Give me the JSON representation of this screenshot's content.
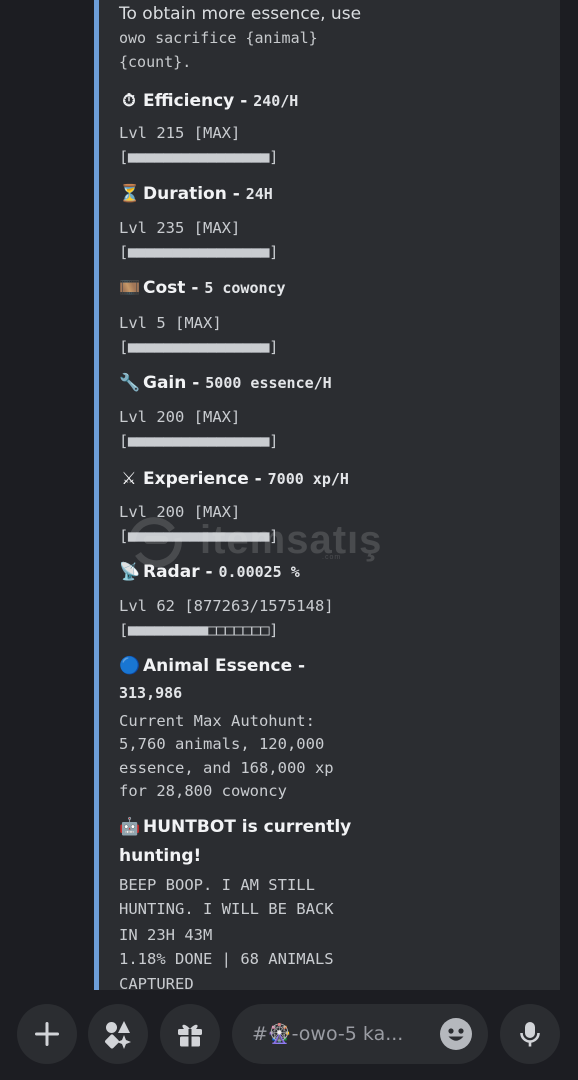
{
  "intro": {
    "line1": "To obtain more essence, use",
    "line2": "owo sacrifice {animal}",
    "line3": "{count}."
  },
  "stats": {
    "efficiency": {
      "emoji": "⏱",
      "name": "Efficiency",
      "value": "240/H",
      "level": "Lvl 215 [MAX]",
      "bar": "[■■■■■■■■■■■■■■■■]"
    },
    "duration": {
      "emoji": "⏳",
      "name": "Duration",
      "value": "24H",
      "level": "Lvl 235 [MAX]",
      "bar": "[■■■■■■■■■■■■■■■■]"
    },
    "cost": {
      "emoji": "🎞️",
      "name": "Cost",
      "value": "5 cowoncy",
      "level": "Lvl 5 [MAX]",
      "bar": "[■■■■■■■■■■■■■■■■]"
    },
    "gain": {
      "emoji": "🔧",
      "name": "Gain",
      "value": "5000 essence/H",
      "level": "Lvl 200 [MAX]",
      "bar": "[■■■■■■■■■■■■■■■■]"
    },
    "experience": {
      "emoji": "⚔",
      "name": "Experience",
      "value": "7000 xp/H",
      "level": "Lvl 200 [MAX]",
      "bar": "[■■■■■■■■■■■■■■■■]"
    },
    "radar": {
      "emoji": "📡",
      "name": "Radar",
      "value": "0.00025 %",
      "level": "Lvl 62 [877263/1575148]",
      "bar": "[■■■■■■■■■□□□□□□□]"
    }
  },
  "essence": {
    "emoji": "🔵",
    "name": "Animal Essence -",
    "value": "313,986",
    "desc1": "Current Max Autohunt:",
    "desc2": "5,760 animals, 120,000",
    "desc3": "essence, and 168,000 xp",
    "desc4": "for 28,800 cowoncy"
  },
  "huntbot": {
    "emoji": "🤖",
    "line1": "HUNTBOT is currently",
    "line2": "hunting!",
    "status1": "BEEP BOOP. I AM STILL",
    "status2": "HUNTING. I WILL BE BACK",
    "status3": "IN 23H 43M",
    "status4": "1.18% DONE | 68 ANIMALS",
    "status5": "CAPTURED"
  },
  "watermark": {
    "text": "itemsatış",
    "sub": ".com"
  },
  "bottom": {
    "input_placeholder": "#🎡-owo-5 ka..."
  },
  "icons": {
    "plus": "plus-icon",
    "apps": "apps-icon",
    "gift": "gift-icon",
    "emoji": "emoji-icon",
    "mic": "microphone-icon"
  },
  "colors": {
    "embed_bar": "#6d9ed8",
    "embed_bg": "#2b2d31",
    "page_bg": "#1c1d22"
  }
}
